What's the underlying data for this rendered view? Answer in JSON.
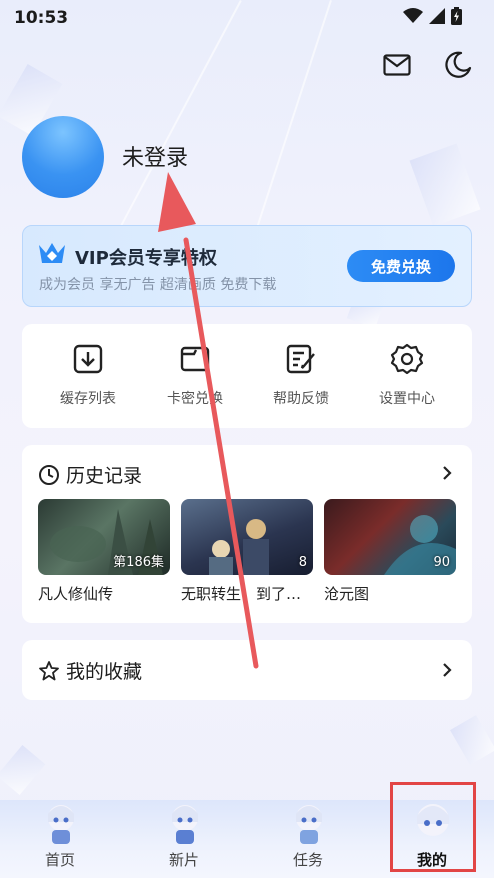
{
  "status_bar": {
    "time": "10:53"
  },
  "header": {
    "mail_icon": "mail-icon",
    "theme_icon": "moon-icon"
  },
  "profile": {
    "login_text": "未登录"
  },
  "vip": {
    "title": "VIP会员专享特权",
    "subtitle": "成为会员 享无广告 超清画质 免费下载",
    "button": "免费兑换",
    "accent_color": "#2d8cf5"
  },
  "actions": [
    {
      "icon": "download-icon",
      "label": "缓存列表"
    },
    {
      "icon": "card-icon",
      "label": "卡密兑换"
    },
    {
      "icon": "edit-icon",
      "label": "帮助反馈"
    },
    {
      "icon": "gear-icon",
      "label": "设置中心"
    }
  ],
  "history": {
    "title": "历史记录",
    "items": [
      {
        "title": "凡人修仙传",
        "badge": "第186集"
      },
      {
        "title": "无职转生：到了异世界就拿出真本事",
        "badge": "8"
      },
      {
        "title": "沧元图",
        "badge": "90"
      }
    ]
  },
  "favorites": {
    "title": "我的收藏"
  },
  "bottom_nav": [
    {
      "label": "首页",
      "active": false
    },
    {
      "label": "新片",
      "active": false
    },
    {
      "label": "任务",
      "active": false
    },
    {
      "label": "我的",
      "active": true
    }
  ],
  "annotation": {
    "highlight_color": "#e24545"
  }
}
